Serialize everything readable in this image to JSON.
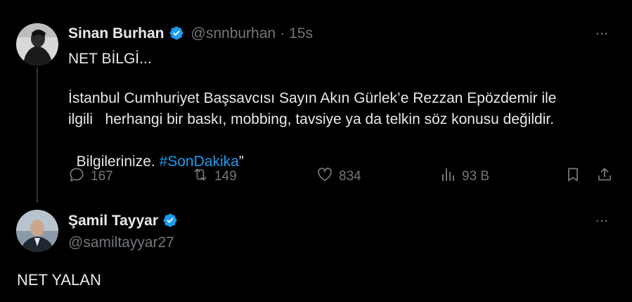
{
  "tweet1": {
    "name": "Sinan Burhan",
    "handle": "@snnburhan",
    "separator": "·",
    "time": "15s",
    "line1": "NET BİLGİ...",
    "line2": "İstanbul Cumhuriyet Başsavcısı Sayın Akın Gürlek’e Rezzan Epözdemir ile",
    "line3": "ilgili   herhangi bir baskı, mobbing, tavsiye ya da telkin söz konusu değildir.",
    "line4_pre": "Bilgilerinize. ",
    "hashtag": "#SonDakika",
    "line4_post": "”",
    "replies": "167",
    "retweets": "149",
    "likes": "834",
    "views": "93 B"
  },
  "tweet2": {
    "name": "Şamil Tayyar",
    "handle": "@samiltayyar27",
    "text": "NET YALAN"
  },
  "more_label": "···",
  "colors": {
    "background": "#000000",
    "text": "#e7e9ea",
    "secondary": "#71767b",
    "accent": "#1d9bf0"
  }
}
